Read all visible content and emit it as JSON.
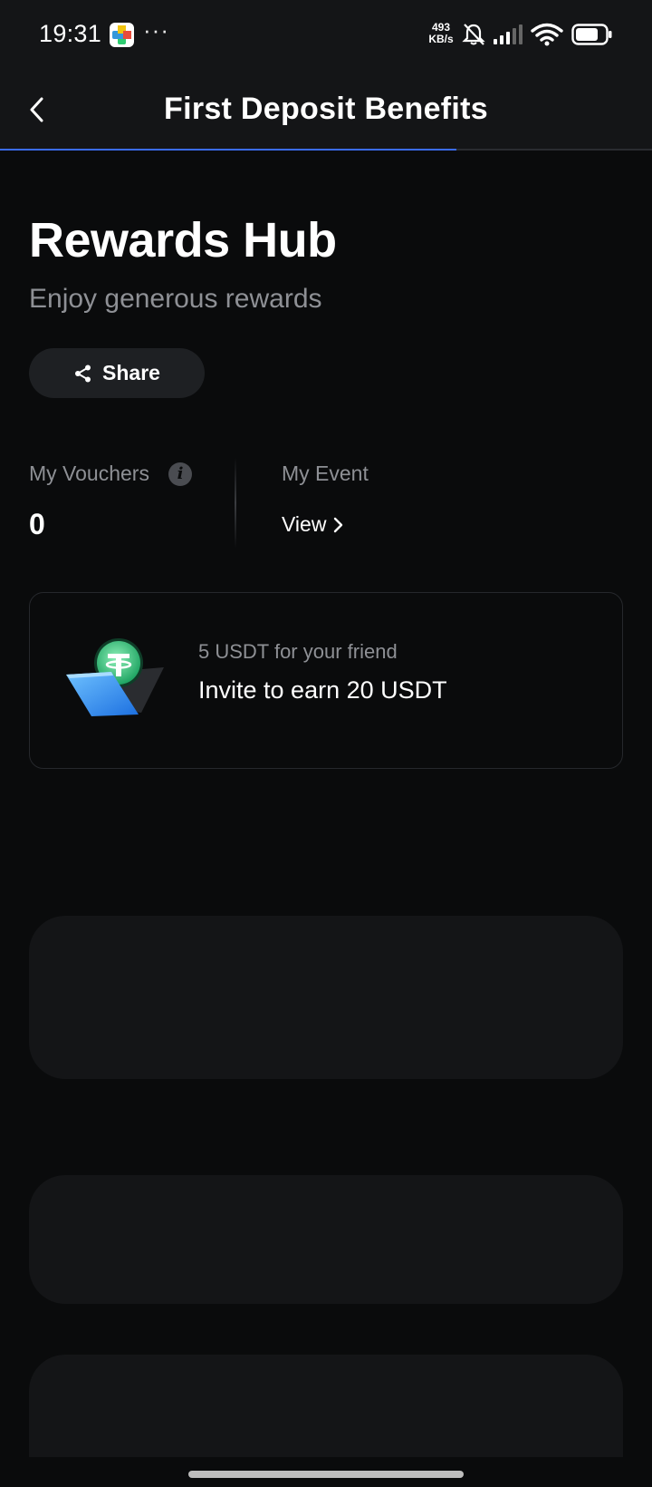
{
  "status_bar": {
    "time": "19:31",
    "dots": "···",
    "net_speed_value": "493",
    "net_speed_unit": "KB/s"
  },
  "nav": {
    "title": "First Deposit Benefits",
    "progress_fraction": 0.7
  },
  "hero": {
    "title": "Rewards Hub",
    "subtitle": "Enjoy generous rewards",
    "share_label": "Share"
  },
  "stats": {
    "vouchers_label": "My Vouchers",
    "vouchers_value": "0",
    "event_label": "My Event",
    "event_link": "View"
  },
  "invite_card": {
    "subtitle": "5 USDT for your friend",
    "title": "Invite to earn 20 USDT",
    "icon": "usdt-coin-wallet-icon"
  },
  "colors": {
    "background": "#0a0b0c",
    "surface": "#141517",
    "accent": "#3b6cf0",
    "muted_text": "#8e9095"
  }
}
